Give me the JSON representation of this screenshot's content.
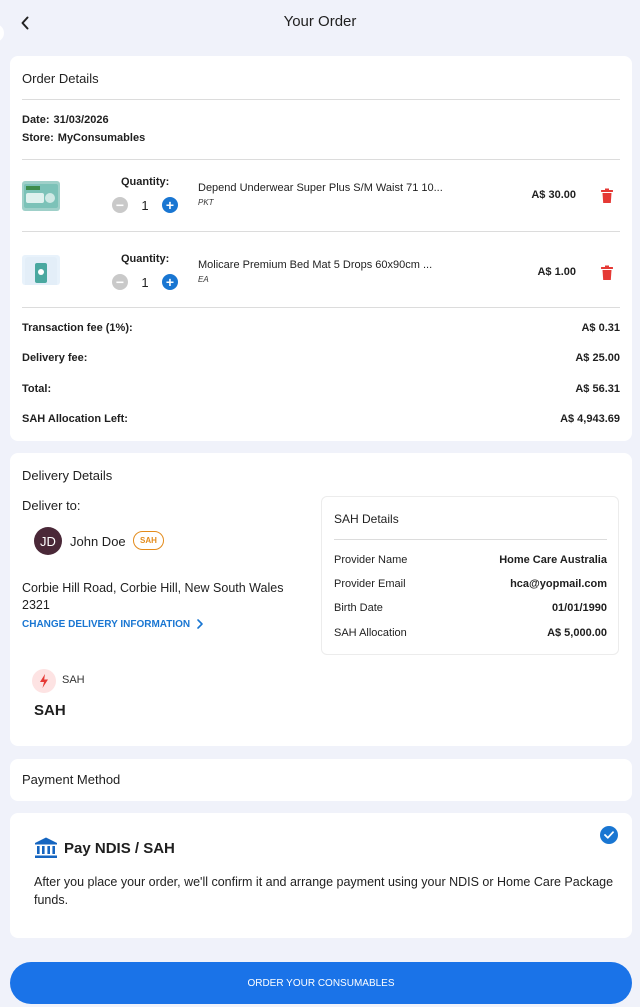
{
  "header": {
    "title": "Your Order",
    "back_icon": "chevron-left-icon"
  },
  "order_details": {
    "title": "Order Details",
    "date_label": "Date:",
    "date_value": "31/03/2026",
    "store_label": "Store:",
    "store_value": "MyConsumables",
    "quantity_label": "Quantity:",
    "items": [
      {
        "name": "Depend Underwear Super Plus S/M Waist 71 10...",
        "unit": "PKT",
        "quantity": "1",
        "price": "A$ 30.00"
      },
      {
        "name": "Molicare Premium Bed Mat 5 Drops 60x90cm ...",
        "unit": "EA",
        "quantity": "1",
        "price": "A$ 1.00"
      }
    ],
    "summary": [
      {
        "label": "Transaction fee (1%):",
        "value": "A$ 0.31"
      },
      {
        "label": "Delivery fee:",
        "value": "A$ 25.00"
      },
      {
        "label": "Total:",
        "value": "A$ 56.31"
      },
      {
        "label": "SAH Allocation Left:",
        "value": "A$ 4,943.69"
      }
    ]
  },
  "delivery": {
    "title": "Delivery Details",
    "deliver_to_label": "Deliver to:",
    "avatar_initials": "JD",
    "user_name": "John Doe",
    "user_badge": "SAH",
    "address": "Corbie Hill Road, Corbie Hill, New South Wales 2321",
    "change_link": "CHANGE DELIVERY INFORMATION",
    "funding_small": "SAH",
    "funding_big": "SAH",
    "sah_details": {
      "title": "SAH Details",
      "rows": [
        {
          "label": "Provider Name",
          "value": "Home Care Australia"
        },
        {
          "label": "Provider Email",
          "value": "hca@yopmail.com"
        },
        {
          "label": "Birth Date",
          "value": "01/01/1990"
        },
        {
          "label": "SAH Allocation",
          "value": "A$ 5,000.00"
        }
      ]
    }
  },
  "payment": {
    "title": "Payment Method",
    "option_title": "Pay NDIS / SAH",
    "option_desc": "After you place your order, we'll confirm it and arrange payment using your NDIS or Home Care Package funds.",
    "selected": true
  },
  "cta": {
    "label": "ORDER YOUR CONSUMABLES"
  },
  "colors": {
    "accent": "#1a73e8",
    "delete": "#e53935",
    "badge": "#e38b1b",
    "avatar": "#4a2838"
  }
}
